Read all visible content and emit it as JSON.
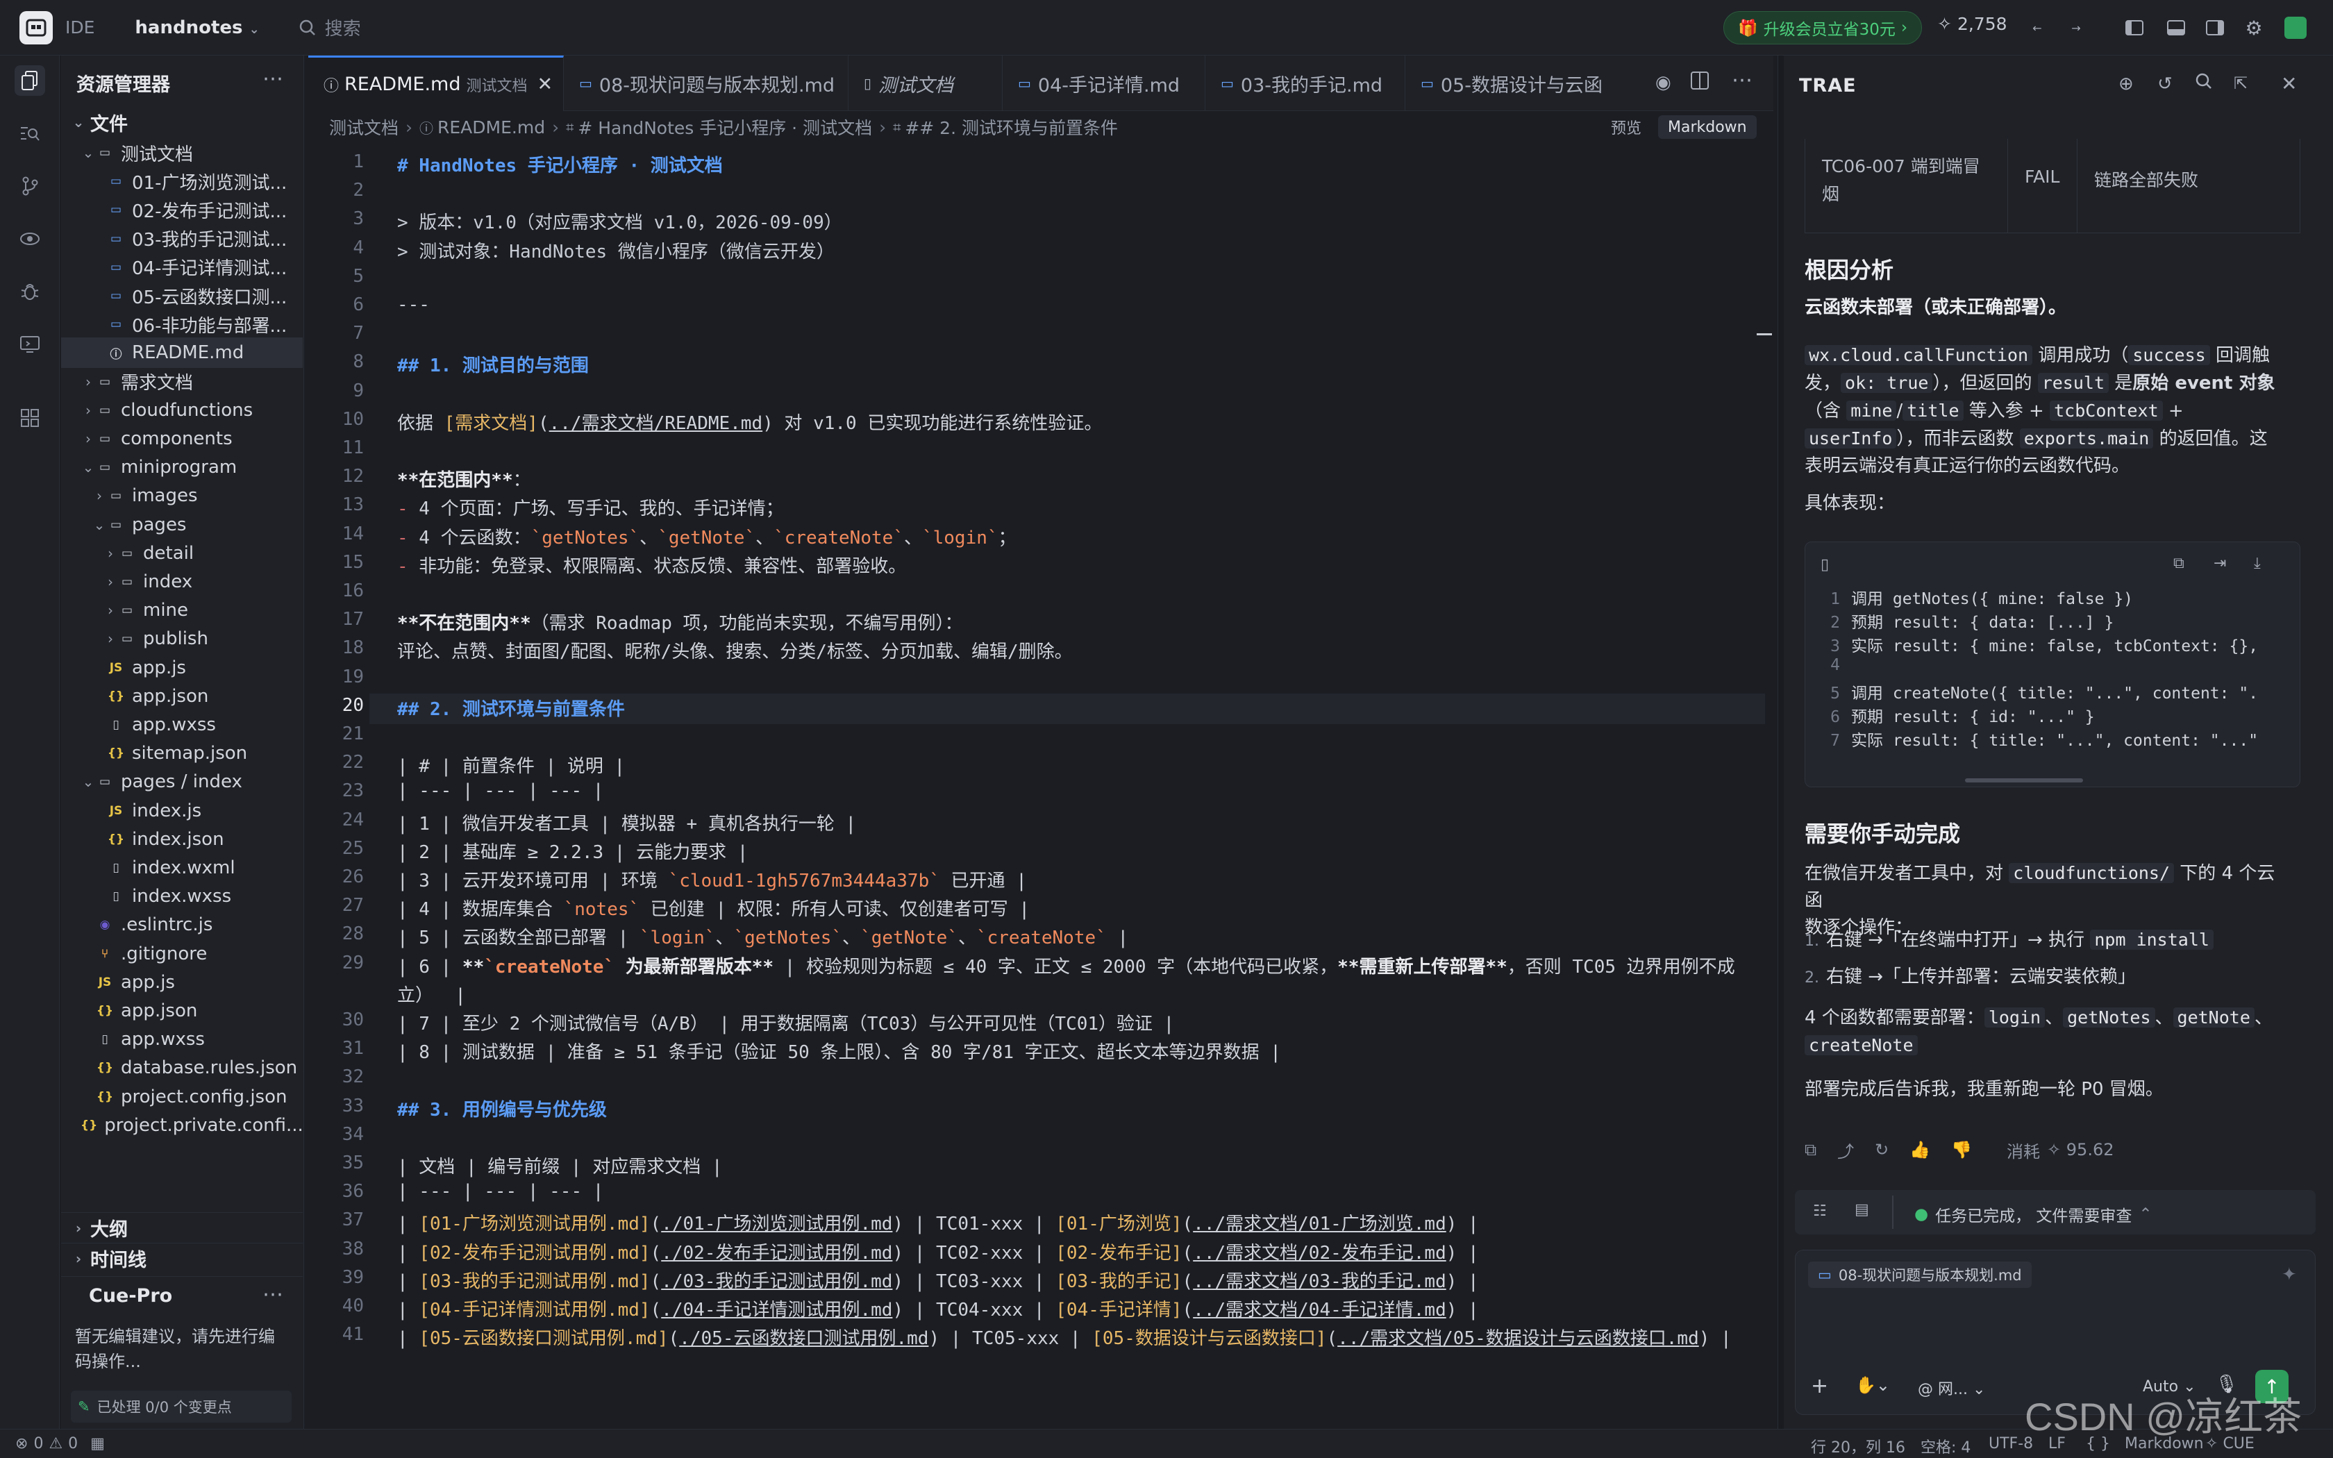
{
  "titlebar": {
    "app_label": "IDE",
    "project": "handnotes",
    "search_placeholder": "搜索",
    "upgrade": "升级会员立省30元",
    "credits": "2,758"
  },
  "explorer": {
    "title": "资源管理器",
    "root": "文件",
    "items": [
      {
        "label": "测试文档",
        "type": "folder",
        "open": true,
        "depth": 1
      },
      {
        "label": "01-广场浏览测试...",
        "type": "md",
        "depth": 2
      },
      {
        "label": "02-发布手记测试...",
        "type": "md",
        "depth": 2
      },
      {
        "label": "03-我的手记测试...",
        "type": "md",
        "depth": 2
      },
      {
        "label": "04-手记详情测试...",
        "type": "md",
        "depth": 2
      },
      {
        "label": "05-云函数接口测...",
        "type": "md",
        "depth": 2
      },
      {
        "label": "06-非功能与部署...",
        "type": "md",
        "depth": 2
      },
      {
        "label": "README.md",
        "type": "info",
        "depth": 2,
        "selected": true
      },
      {
        "label": "需求文档",
        "type": "folder",
        "open": false,
        "depth": 1
      },
      {
        "label": "cloudfunctions",
        "type": "folder",
        "open": false,
        "depth": 1
      },
      {
        "label": "components",
        "type": "folder",
        "open": false,
        "depth": 1
      },
      {
        "label": "miniprogram",
        "type": "folder",
        "open": true,
        "depth": 1
      },
      {
        "label": "images",
        "type": "folder",
        "open": false,
        "depth": 2
      },
      {
        "label": "pages",
        "type": "folder",
        "open": true,
        "depth": 2
      },
      {
        "label": "detail",
        "type": "folder",
        "open": false,
        "depth": 3
      },
      {
        "label": "index",
        "type": "folder",
        "open": false,
        "depth": 3
      },
      {
        "label": "mine",
        "type": "folder",
        "open": false,
        "depth": 3
      },
      {
        "label": "publish",
        "type": "folder",
        "open": false,
        "depth": 3
      },
      {
        "label": "app.js",
        "type": "js",
        "depth": 2
      },
      {
        "label": "app.json",
        "type": "json",
        "depth": 2
      },
      {
        "label": "app.wxss",
        "type": "file",
        "depth": 2
      },
      {
        "label": "sitemap.json",
        "type": "json",
        "depth": 2
      },
      {
        "label": "pages / index",
        "type": "folder",
        "open": true,
        "depth": 1
      },
      {
        "label": "index.js",
        "type": "js",
        "depth": 2
      },
      {
        "label": "index.json",
        "type": "json",
        "depth": 2
      },
      {
        "label": "index.wxml",
        "type": "file",
        "depth": 2
      },
      {
        "label": "index.wxss",
        "type": "file",
        "depth": 2
      },
      {
        "label": ".eslintrc.js",
        "type": "eslint",
        "depth": 1
      },
      {
        "label": ".gitignore",
        "type": "git",
        "depth": 1
      },
      {
        "label": "app.js",
        "type": "js",
        "depth": 1
      },
      {
        "label": "app.json",
        "type": "json",
        "depth": 1
      },
      {
        "label": "app.wxss",
        "type": "file",
        "depth": 1
      },
      {
        "label": "database.rules.json",
        "type": "json",
        "depth": 1
      },
      {
        "label": "project.config.json",
        "type": "json",
        "depth": 1
      },
      {
        "label": "project.private.confi...",
        "type": "json",
        "depth": 1
      }
    ],
    "outline": "大纲",
    "timeline": "时间线",
    "cue_title": "Cue-Pro",
    "cue_text1": "暂无编辑建议，请先进行编",
    "cue_text2": "码操作...",
    "cue_status": "已处理 0/0 个变更点"
  },
  "tabs": [
    {
      "label": "README.md",
      "sub": "测试文档",
      "active": true
    },
    {
      "label": "08-现状问题与版本规划.md"
    },
    {
      "label": "测试文档"
    },
    {
      "label": "04-手记详情.md"
    },
    {
      "label": "03-我的手记.md"
    },
    {
      "label": "05-数据设计与云函"
    }
  ],
  "breadcrumb": [
    "测试文档",
    "README.md",
    "# HandNotes 手记小程序 · 测试文档",
    "## 2. 测试环境与前置条件"
  ],
  "preview_label": "预览",
  "lang_label": "Markdown",
  "code_lines": [
    "# HandNotes 手记小程序 · 测试文档",
    "",
    "> 版本：v1.0（对应需求文档 v1.0，2026-09-09）",
    "> 测试对象：HandNotes 微信小程序（微信云开发）",
    "",
    "---",
    "",
    "## 1. 测试目的与范围",
    "",
    "依据 [需求文档](../需求文档/README.md) 对 v1.0 已实现功能进行系统性验证。",
    "",
    "**在范围内**：",
    "- 4 个页面：广场、写手记、我的、手记详情；",
    "- 4 个云函数：`getNotes`、`getNote`、`createNote`、`login`；",
    "- 非功能：免登录、权限隔离、状态反馈、兼容性、部署验收。",
    "",
    "**不在范围内**（需求 Roadmap 项，功能尚未实现，不编写用例）：",
    "评论、点赞、封面图/配图、昵称/头像、搜索、分类/标签、分页加载、编辑/删除。",
    "",
    "## 2. 测试环境与前置条件",
    "",
    "| # | 前置条件 | 说明 |",
    "| --- | --- | --- |",
    "| 1 | 微信开发者工具 | 模拟器 + 真机各执行一轮 |",
    "| 2 | 基础库 ≥ 2.2.3 | 云能力要求 |",
    "| 3 | 云开发环境可用 | 环境 `cloud1-1gh5767m3444a37b` 已开通 |",
    "| 4 | 数据库集合 `notes` 已创建 | 权限：所有人可读、仅创建者可写 |",
    "| 5 | 云函数全部已部署 | `login`、`getNotes`、`getNote`、`createNote` |",
    "| 6 | **`createNote` 为最新部署版本** | 校验规则为标题 ≤ 40 字、正文 ≤ 2000 字（本地代码已收紧，**需重新上传部署**，否则 TC05 边界用例不成",
    "| 7 | 至少 2 个测试微信号（A/B） | 用于数据隔离（TC03）与公开可见性（TC01）验证 |",
    "| 8 | 测试数据 | 准备 ≥ 51 条手记（验证 50 条上限）、含 80 字/81 字正文、超长文本等边界数据 |",
    "",
    "## 3. 用例编号与优先级",
    "",
    "| 文档 | 编号前缀 | 对应需求文档 |",
    "| --- | --- | --- |",
    "| [01-广场浏览测试用例.md](./01-广场浏览测试用例.md) | TC01-xxx | [01-广场浏览](../需求文档/01-广场浏览.md) |",
    "| [02-发布手记测试用例.md](./02-发布手记测试用例.md) | TC02-xxx | [02-发布手记](../需求文档/02-发布手记.md) |",
    "| [03-我的手记测试用例.md](./03-我的手记测试用例.md) | TC03-xxx | [03-我的手记](../需求文档/03-我的手记.md) |",
    "| [04-手记详情测试用例.md](./04-手记详情测试用例.md) | TC04-xxx | [04-手记详情](../需求文档/04-手记详情.md) |",
    "| [05-云函数接口测试用例.md](./05-云函数接口测试用例.md) | TC05-xxx | [05-数据设计与云函数接口](../需求文档/05-数据设计与云函数接口.md) |"
  ],
  "code_wrap_29": "立）  |",
  "ai": {
    "title": "TRAE",
    "table_cells": [
      "TC06-007 端到端冒",
      "烟",
      "FAIL",
      "链路全部失败"
    ],
    "h_root": "根因分析",
    "p1": "云函数未部署（或未正确部署）。",
    "p2_a": "wx.cloud.callFunction",
    "p2_b": " 调用成功（",
    "p2_c": "success",
    "p2_d": " 回调触",
    "p2_e": "发，",
    "p2_f": "ok: true",
    "p2_g": "），但返回的 ",
    "p2_h": "result",
    "p2_i": " 是",
    "p2_j": "原始 event 对象",
    "p2_k": "（含 ",
    "p2_l": "mine",
    "p2_m": "/",
    "p2_n": "title",
    "p2_o": " 等入参 + ",
    "p2_p": "tcbContext",
    "p2_q": " +",
    "p2_r": "userInfo",
    "p2_s": "），而非云函数 ",
    "p2_t": "exports.main",
    "p2_u": " 的返回值。这",
    "p2_v": "表明云端没有真正运行你的云函数代码。",
    "p3": "具体表现：",
    "code": [
      {
        "n": "1",
        "t": "调用 getNotes({ mine: false })"
      },
      {
        "n": "2",
        "t": "预期 result: { data: [...] }"
      },
      {
        "n": "3",
        "t": "实际 result: { mine: false, tcbContext: {},"
      },
      {
        "n": "4",
        "t": ""
      },
      {
        "n": "5",
        "t": "调用 createNote({ title: \"...\", content: \"."
      },
      {
        "n": "6",
        "t": "预期 result: { id: \"...\" }"
      },
      {
        "n": "7",
        "t": "实际 result: { title: \"...\", content: \"...\""
      }
    ],
    "h_manual": "需要你手动完成",
    "p4_a": "在微信开发者工具中，对 ",
    "p4_b": "cloudfunctions/",
    "p4_c": " 下的 4 个云函",
    "p4_d": "数逐个操作：",
    "step1_a": "右键 →「在终端中打开」→ 执行 ",
    "step1_b": "npm install",
    "step2": "右键 →「上传并部署：云端安装依赖」",
    "p5_a": "4 个函数都需要部署：",
    "p5_fn1": "login",
    "p5_fn2": "getNotes",
    "p5_fn3": "getNote",
    "p5_fn4": "createNote",
    "p6": "部署完成后告诉我，我重新跑一轮 P0 冒烟。",
    "consume_label": "消耗",
    "consume_value": "95.62",
    "task_status": "任务已完成， 文件需要审查",
    "attach": "08-现状问题与版本规划.md",
    "web_label": "@ 网...",
    "auto_label": "Auto"
  },
  "status": {
    "errors": "0",
    "warnings": "0",
    "position": "行 20，列 16",
    "spaces": "空格: 4",
    "encoding": "UTF-8",
    "eol": "LF",
    "braces": "{ }",
    "mode": "Markdown",
    "cue": "CUE"
  },
  "watermark": "CSDN @凉红茶"
}
